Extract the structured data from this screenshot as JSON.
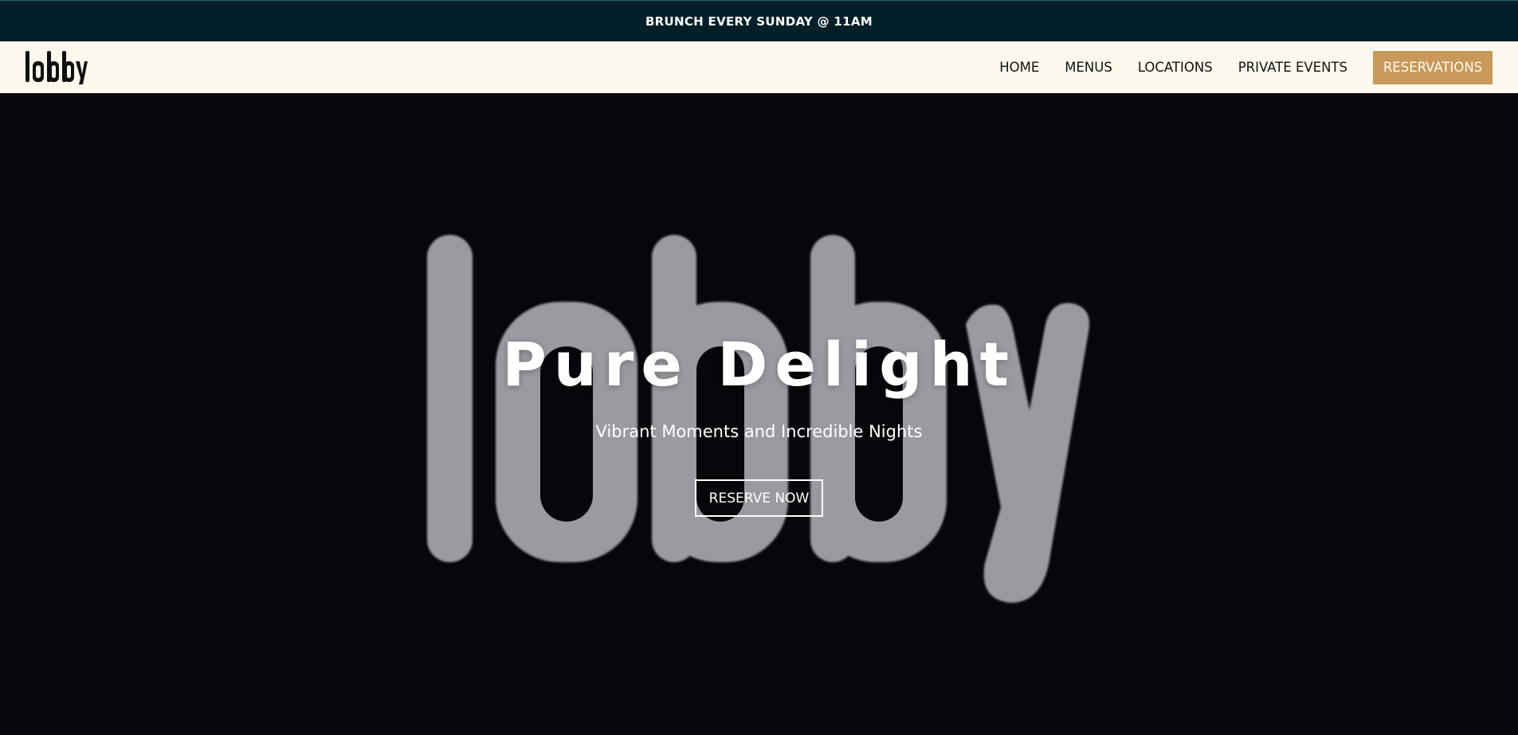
{
  "announcement": {
    "text": "BRUNCH EVERY SUNDAY @ 11AM"
  },
  "header": {
    "logo_text": "lobby",
    "nav_items": [
      {
        "label": "HOME"
      },
      {
        "label": "MENUS"
      },
      {
        "label": "LOCATIONS"
      },
      {
        "label": "PRIVATE EVENTS"
      }
    ],
    "cta_label": "RESERVATIONS"
  },
  "hero": {
    "background_wordmark": "lobby",
    "title": "Pure Delight",
    "subtitle": "Vibrant Moments and Incredible Nights",
    "button_label": "RESERVE NOW"
  },
  "colors": {
    "announcement_bg": "#03202a",
    "nav_bg": "#fcf8ed",
    "cta_bg": "#c8995a",
    "hero_bg": "#08060b",
    "wordmark": "#9c9aa1"
  }
}
